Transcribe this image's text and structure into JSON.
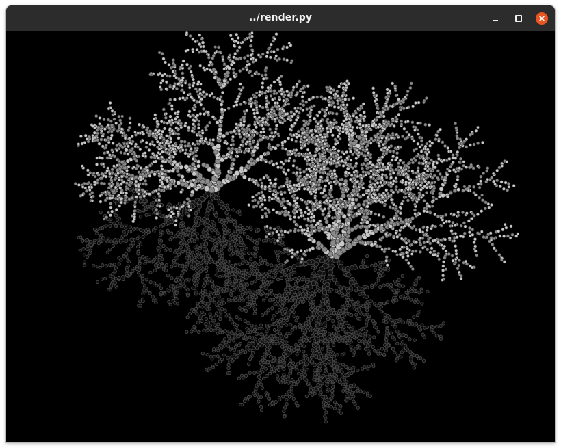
{
  "window": {
    "title": "../render.py",
    "buttons": [
      {
        "name": "minimize",
        "icon": "minimize-icon"
      },
      {
        "name": "maximize",
        "icon": "maximize-icon"
      },
      {
        "name": "close",
        "icon": "close-icon"
      }
    ],
    "colors": {
      "titlebar": "#2c2c2c",
      "title_text": "#f2f2f2",
      "close_button": "#e95420",
      "canvas_background": "#000000"
    }
  },
  "canvas": {
    "content": "fractal-dendrite-render",
    "palette": {
      "bright": "#c8c8c8",
      "mid": "#8a8a8a",
      "dim": "#4a4a4a",
      "outline": "#9a9a9a"
    }
  }
}
